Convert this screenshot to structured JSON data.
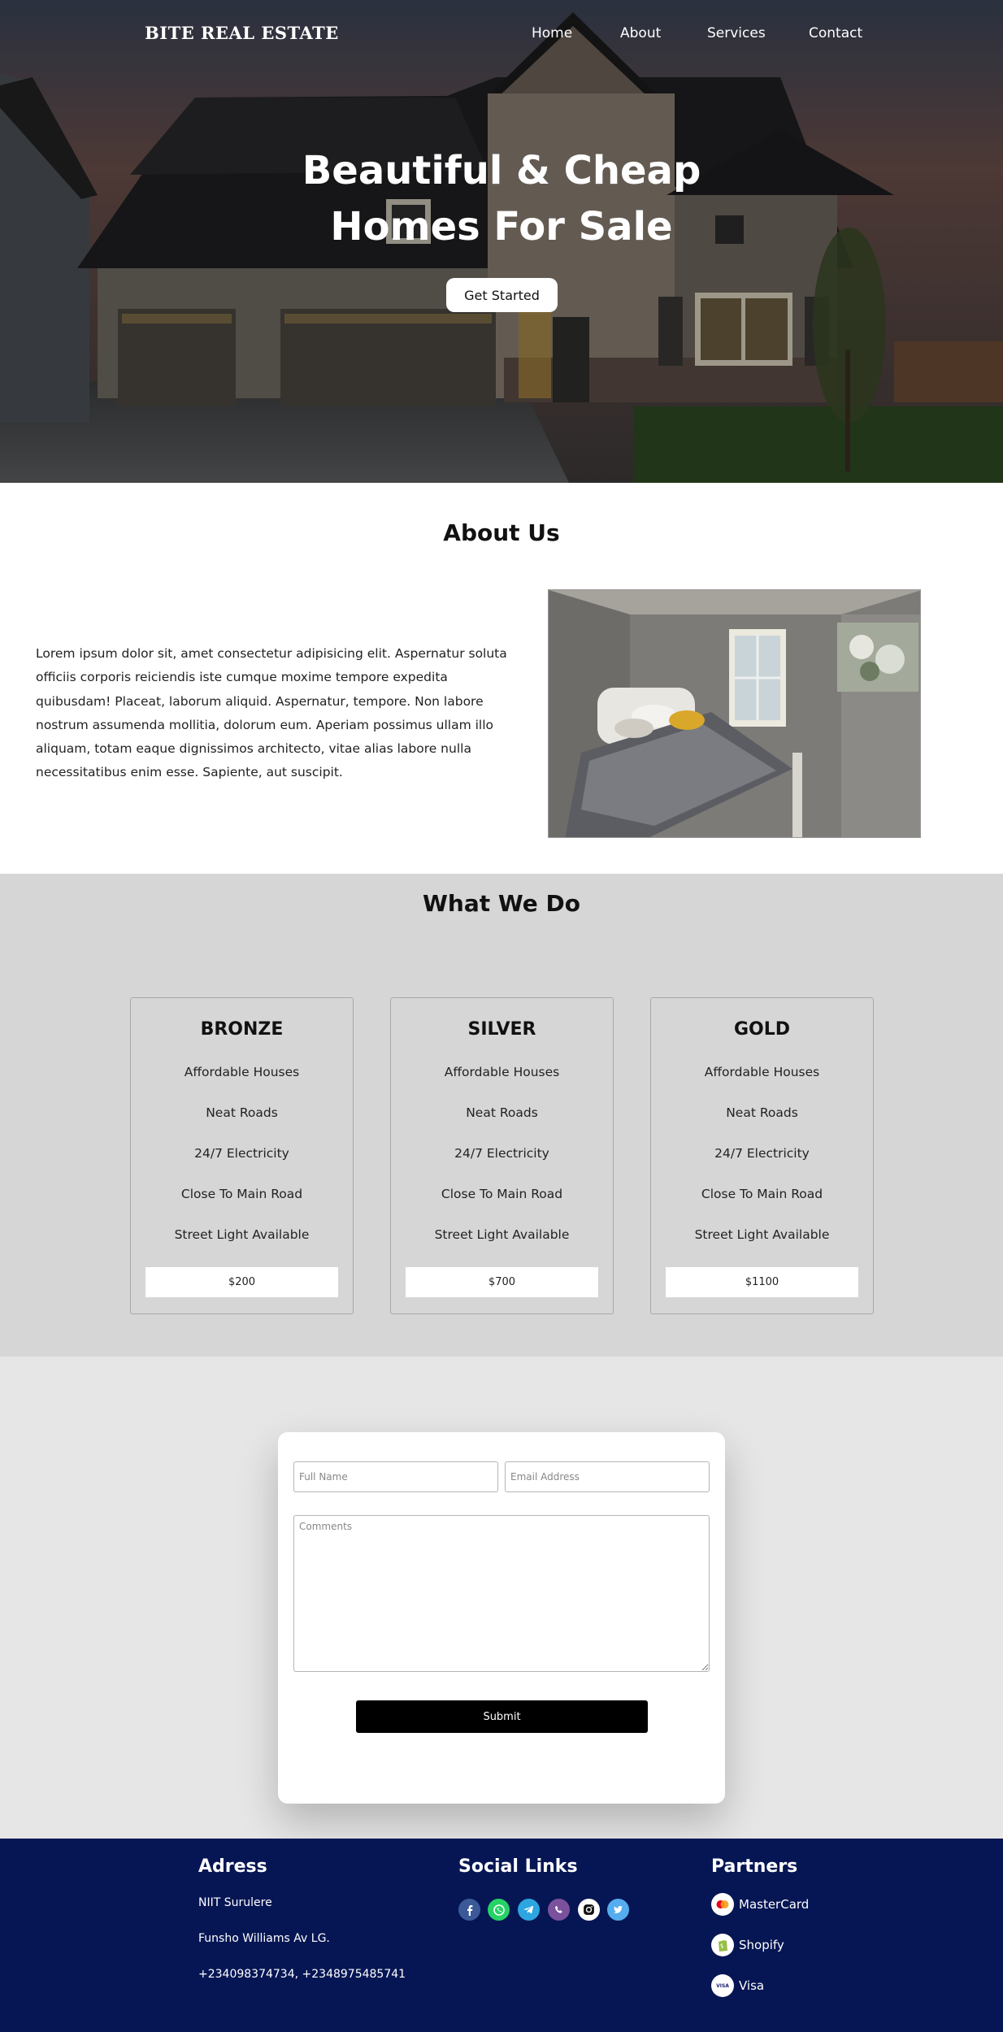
{
  "nav": {
    "logo": "BITE REAL ESTATE",
    "links": [
      "Home",
      "About",
      "Services",
      "Contact"
    ]
  },
  "hero": {
    "title_line1": "Beautiful & Cheap",
    "title_line2": "Homes For Sale",
    "cta": "Get Started"
  },
  "about": {
    "title": "About Us",
    "text": "Lorem ipsum dolor sit, amet consectetur adipisicing elit. Aspernatur soluta officiis corporis reiciendis iste cumque moxime tempore expedita quibusdam! Placeat, laborum aliquid. Aspernatur, tempore. Non labore nostrum assumenda mollitia, dolorum eum. Aperiam possimus ullam illo aliquam, totam eaque dignissimos architecto, vitae alias labore nulla necessitatibus enim esse. Sapiente, aut suscipit."
  },
  "services": {
    "title": "What We Do",
    "plans": [
      {
        "name": "BRONZE",
        "features": [
          "Affordable Houses",
          "Neat Roads",
          "24/7 Electricity",
          "Close To Main Road",
          "Street Light Available"
        ],
        "price": "$200"
      },
      {
        "name": "SILVER",
        "features": [
          "Affordable Houses",
          "Neat Roads",
          "24/7 Electricity",
          "Close To Main Road",
          "Street Light Available"
        ],
        "price": "$700"
      },
      {
        "name": "GOLD",
        "features": [
          "Affordable Houses",
          "Neat Roads",
          "24/7 Electricity",
          "Close To Main Road",
          "Street Light Available"
        ],
        "price": "$1100"
      }
    ]
  },
  "contact": {
    "fullname_placeholder": "Full Name",
    "email_placeholder": "Email Address",
    "comments_placeholder": "Comments",
    "submit": "Submit"
  },
  "footer": {
    "address_title": "Adress",
    "address_lines": [
      "NIIT Surulere",
      "Funsho Williams Av LG.",
      "+234098374734, +2348975485741"
    ],
    "social_title": "Social Links",
    "social_icons": [
      "facebook-icon",
      "whatsapp-icon",
      "telegram-icon",
      "viber-icon",
      "instagram-icon",
      "twitter-icon"
    ],
    "partners_title": "Partners",
    "partners": [
      "MasterCard",
      "Shopify",
      "Visa"
    ],
    "partner_icon_text": {
      "visa": "VISA"
    }
  },
  "colors": {
    "footer_bg": "#061654",
    "services_bg": "#d6d6d6",
    "contact_bg": "#e6e6e6"
  }
}
